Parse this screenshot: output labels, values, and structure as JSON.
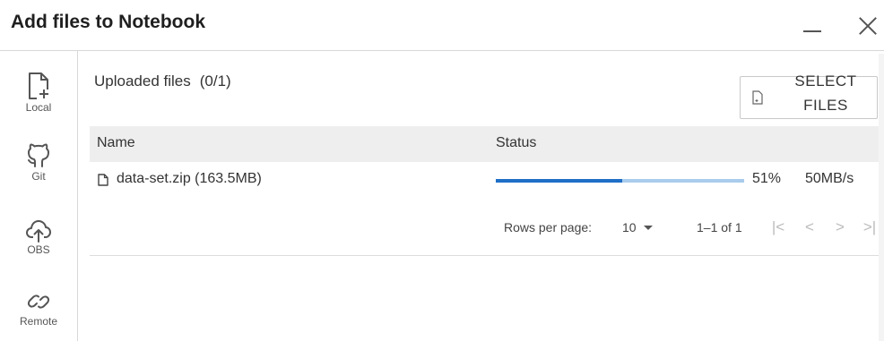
{
  "dialog": {
    "title": "Add files to Notebook",
    "minimize_icon": "minimize-icon",
    "close_icon": "close-icon"
  },
  "sidebar": {
    "items": [
      {
        "label": "Local",
        "icon": "file-add-icon"
      },
      {
        "label": "Git",
        "icon": "github-icon"
      },
      {
        "label": "OBS",
        "icon": "cloud-upload-icon"
      },
      {
        "label": "Remote",
        "icon": "link-icon"
      }
    ]
  },
  "main": {
    "uploaded_label": "Uploaded files",
    "uploaded_count": "(0/1)",
    "select_button": {
      "label_line1": "SELECT",
      "label_line2": "FILES",
      "icon": "file-icon"
    },
    "table": {
      "columns": [
        "Name",
        "Status"
      ],
      "rows": [
        {
          "name": "data-set.zip (163.5MB)",
          "progress": 0.51,
          "percent": "51%",
          "speed": "50MB/s",
          "icon": "file-icon"
        }
      ]
    },
    "pagination": {
      "rows_per_page_label": "Rows per page:",
      "rows_per_page_value": "10",
      "range": "1–1 of 1",
      "first_icon": "first-page-icon",
      "prev_icon": "chevron-left-icon",
      "next_icon": "chevron-right-icon",
      "last_icon": "last-page-icon"
    }
  },
  "colors": {
    "progress_fill": "#1f6fc7",
    "progress_track": "#a9ccec",
    "header_bg": "#eeeeee"
  }
}
